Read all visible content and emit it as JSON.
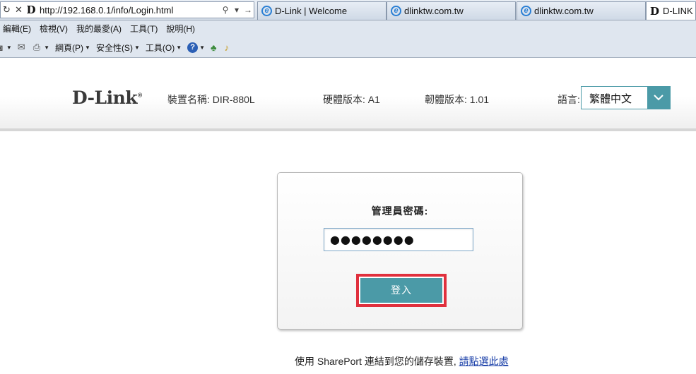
{
  "browser": {
    "address": {
      "url": "http://192.168.0.1/info/Login.html"
    },
    "tabs": [
      {
        "label": "D-Link | Welcome",
        "icon": "ie-page-icon"
      },
      {
        "label": "dlinktw.com.tw",
        "icon": "ie-page-icon"
      },
      {
        "label": "dlinktw.com.tw",
        "icon": "ie-page-icon"
      },
      {
        "label": "D-LINK",
        "icon": "dlink-favicon"
      }
    ],
    "menu": [
      "編輯(E)",
      "檢視(V)",
      "我的最愛(A)",
      "工具(T)",
      "說明(H)"
    ],
    "commands": {
      "page": "網頁(P)",
      "safety": "安全性(S)",
      "tools": "工具(O)"
    }
  },
  "header": {
    "logo_text": "D-Link",
    "device_name": "裝置名稱: DIR-880L",
    "hardware_version": "硬體版本: A1",
    "firmware_version": "韌體版本: 1.01",
    "language_label": "語言:",
    "language_value": "繁體中文"
  },
  "login": {
    "password_label": "管理員密碼:",
    "password_value": "●●●●●●●●",
    "login_button": "登入"
  },
  "footer": {
    "sharepoint_text": "使用 SharePort 連結到您的儲存裝置,",
    "sharepoint_link": "請點選此處"
  },
  "colors": {
    "accent": "#4b9aa7",
    "highlight": "#e0303d",
    "link": "#1a3fa8"
  }
}
